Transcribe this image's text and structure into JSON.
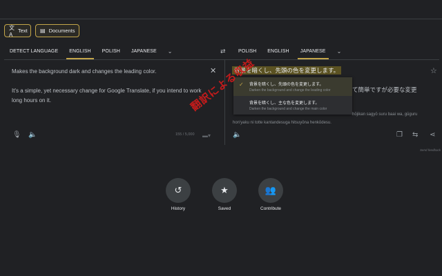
{
  "mode_buttons": [
    {
      "label": "Text",
      "icon": "translate-icon"
    },
    {
      "label": "Documents",
      "icon": "document-icon"
    }
  ],
  "source_tabs": [
    "DETECT LANGUAGE",
    "ENGLISH",
    "POLISH",
    "JAPANESE"
  ],
  "source_active": "ENGLISH",
  "target_tabs": [
    "POLISH",
    "ENGLISH",
    "JAPANESE"
  ],
  "target_active": "JAPANESE",
  "source_text": {
    "line1": "Makes the background dark and changes the leading color.",
    "line2": "It's a simple, yet necessary change for Google Translate, if you intend to work long hours on it."
  },
  "char_counter": "155 / 5,000",
  "translation": {
    "main": "背景を暗くし、先頭の色を変更します。",
    "line2_visible": "て簡単ですが必要な変更",
    "romaji_line1": "hōjikan sagyō suru baai wa, gūguru",
    "romaji_line2": "hon'yaku ni totte kantandesuga hitsuyōna henkōdesu."
  },
  "alternatives": [
    {
      "text": "背景を暗くし、先頭の色を変更します。",
      "gloss": "Darken the background and change the leading color",
      "selected": true
    },
    {
      "text": "背景を暗くし、主な色を変更します。",
      "gloss": "Darken the background and change the main color",
      "selected": false
    }
  ],
  "feedback": "Send feedback",
  "stamp": "翻訳による収益",
  "bottom_actions": [
    {
      "label": "History",
      "icon": "history-icon"
    },
    {
      "label": "Saved",
      "icon": "star-icon"
    },
    {
      "label": "Contribute",
      "icon": "contribute-icon"
    }
  ],
  "colors": {
    "accent": "#c4a64a",
    "background": "#202124",
    "highlight": "#5b5222"
  }
}
